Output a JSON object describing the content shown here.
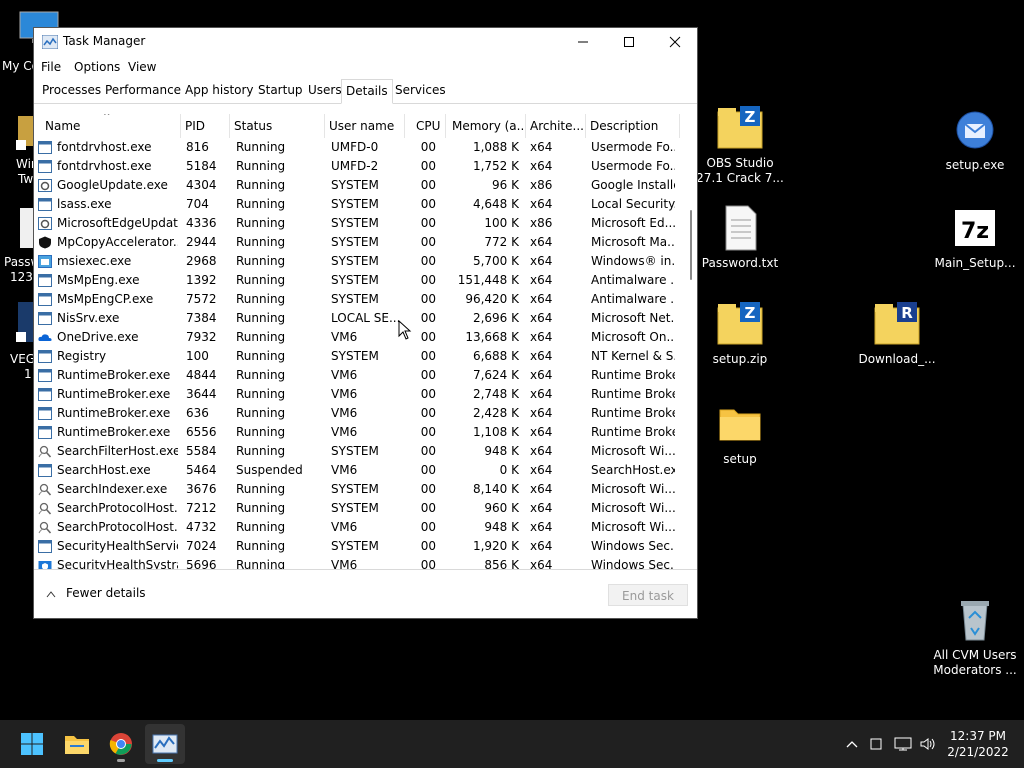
{
  "desktop": {
    "partial_labels": [
      "My Co",
      "Win",
      "Tw",
      "Passw",
      "123",
      "VEG",
      "1"
    ],
    "icons": [
      {
        "label_line1": "OBS Studio",
        "label_line2": "27.1 Crack 7...",
        "icon": "winzip-icon"
      },
      {
        "label_line1": "setup.exe",
        "label_line2": "",
        "icon": "setup-installer-icon"
      },
      {
        "label_line1": "Password.txt",
        "label_line2": "",
        "icon": "text-file-icon"
      },
      {
        "label_line1": "Main_Setup...",
        "label_line2": "",
        "icon": "7zip-icon"
      },
      {
        "label_line1": "setup.zip",
        "label_line2": "",
        "icon": "winzip-icon"
      },
      {
        "label_line1": "Download_...",
        "label_line2": "",
        "icon": "winrar-icon"
      },
      {
        "label_line1": "setup",
        "label_line2": "",
        "icon": "folder-icon"
      },
      {
        "label_line1": "All CVM Users",
        "label_line2": "Moderators ...",
        "icon": "recycle-bin-icon"
      }
    ]
  },
  "window": {
    "title": "Task Manager",
    "menu": [
      "File",
      "Options",
      "View"
    ],
    "tabs": [
      "Processes",
      "Performance",
      "App history",
      "Startup",
      "Users",
      "Details",
      "Services"
    ],
    "active_tab": "Details"
  },
  "table": {
    "columns": [
      "Name",
      "PID",
      "Status",
      "User name",
      "CPU",
      "Memory (a...",
      "Archite...",
      "Description"
    ],
    "rows": [
      {
        "name": "fontdrvhost.exe",
        "pid": "816",
        "status": "Running",
        "user": "UMFD-0",
        "cpu": "00",
        "mem": "1,088 K",
        "arch": "x64",
        "desc": "Usermode Fo...",
        "icon": "app-window-icon"
      },
      {
        "name": "fontdrvhost.exe",
        "pid": "5184",
        "status": "Running",
        "user": "UMFD-2",
        "cpu": "00",
        "mem": "1,752 K",
        "arch": "x64",
        "desc": "Usermode Fo...",
        "icon": "app-window-icon"
      },
      {
        "name": "GoogleUpdate.exe",
        "pid": "4304",
        "status": "Running",
        "user": "SYSTEM",
        "cpu": "00",
        "mem": "96 K",
        "arch": "x86",
        "desc": "Google Installer",
        "icon": "gear-app-icon"
      },
      {
        "name": "lsass.exe",
        "pid": "704",
        "status": "Running",
        "user": "SYSTEM",
        "cpu": "00",
        "mem": "4,648 K",
        "arch": "x64",
        "desc": "Local Security...",
        "icon": "app-window-icon"
      },
      {
        "name": "MicrosoftEdgeUpdat...",
        "pid": "4336",
        "status": "Running",
        "user": "SYSTEM",
        "cpu": "00",
        "mem": "100 K",
        "arch": "x86",
        "desc": "Microsoft Ed...",
        "icon": "gear-app-icon"
      },
      {
        "name": "MpCopyAccelerator....",
        "pid": "2944",
        "status": "Running",
        "user": "SYSTEM",
        "cpu": "00",
        "mem": "772 K",
        "arch": "x64",
        "desc": "Microsoft Ma...",
        "icon": "shield-icon"
      },
      {
        "name": "msiexec.exe",
        "pid": "2968",
        "status": "Running",
        "user": "SYSTEM",
        "cpu": "00",
        "mem": "5,700 K",
        "arch": "x64",
        "desc": "Windows® in...",
        "icon": "installer-icon"
      },
      {
        "name": "MsMpEng.exe",
        "pid": "1392",
        "status": "Running",
        "user": "SYSTEM",
        "cpu": "00",
        "mem": "151,448 K",
        "arch": "x64",
        "desc": "Antimalware ...",
        "icon": "app-window-icon"
      },
      {
        "name": "MsMpEngCP.exe",
        "pid": "7572",
        "status": "Running",
        "user": "SYSTEM",
        "cpu": "00",
        "mem": "96,420 K",
        "arch": "x64",
        "desc": "Antimalware ...",
        "icon": "app-window-icon"
      },
      {
        "name": "NisSrv.exe",
        "pid": "7384",
        "status": "Running",
        "user": "LOCAL SE...",
        "cpu": "00",
        "mem": "2,696 K",
        "arch": "x64",
        "desc": "Microsoft Net...",
        "icon": "app-window-icon"
      },
      {
        "name": "OneDrive.exe",
        "pid": "7932",
        "status": "Running",
        "user": "VM6",
        "cpu": "00",
        "mem": "13,668 K",
        "arch": "x64",
        "desc": "Microsoft On...",
        "icon": "onedrive-icon"
      },
      {
        "name": "Registry",
        "pid": "100",
        "status": "Running",
        "user": "SYSTEM",
        "cpu": "00",
        "mem": "6,688 K",
        "arch": "x64",
        "desc": "NT Kernel & S...",
        "icon": "app-window-icon"
      },
      {
        "name": "RuntimeBroker.exe",
        "pid": "4844",
        "status": "Running",
        "user": "VM6",
        "cpu": "00",
        "mem": "7,624 K",
        "arch": "x64",
        "desc": "Runtime Broker",
        "icon": "app-window-icon"
      },
      {
        "name": "RuntimeBroker.exe",
        "pid": "3644",
        "status": "Running",
        "user": "VM6",
        "cpu": "00",
        "mem": "2,748 K",
        "arch": "x64",
        "desc": "Runtime Broker",
        "icon": "app-window-icon"
      },
      {
        "name": "RuntimeBroker.exe",
        "pid": "636",
        "status": "Running",
        "user": "VM6",
        "cpu": "00",
        "mem": "2,428 K",
        "arch": "x64",
        "desc": "Runtime Broker",
        "icon": "app-window-icon"
      },
      {
        "name": "RuntimeBroker.exe",
        "pid": "6556",
        "status": "Running",
        "user": "VM6",
        "cpu": "00",
        "mem": "1,108 K",
        "arch": "x64",
        "desc": "Runtime Broker",
        "icon": "app-window-icon"
      },
      {
        "name": "SearchFilterHost.exe",
        "pid": "5584",
        "status": "Running",
        "user": "SYSTEM",
        "cpu": "00",
        "mem": "948 K",
        "arch": "x64",
        "desc": "Microsoft Wi...",
        "icon": "search-person-icon"
      },
      {
        "name": "SearchHost.exe",
        "pid": "5464",
        "status": "Suspended",
        "user": "VM6",
        "cpu": "00",
        "mem": "0 K",
        "arch": "x64",
        "desc": "SearchHost.exe",
        "icon": "app-window-icon"
      },
      {
        "name": "SearchIndexer.exe",
        "pid": "3676",
        "status": "Running",
        "user": "SYSTEM",
        "cpu": "00",
        "mem": "8,140 K",
        "arch": "x64",
        "desc": "Microsoft Wi...",
        "icon": "search-person-icon"
      },
      {
        "name": "SearchProtocolHost....",
        "pid": "7212",
        "status": "Running",
        "user": "SYSTEM",
        "cpu": "00",
        "mem": "960 K",
        "arch": "x64",
        "desc": "Microsoft Wi...",
        "icon": "search-person-icon"
      },
      {
        "name": "SearchProtocolHost....",
        "pid": "4732",
        "status": "Running",
        "user": "VM6",
        "cpu": "00",
        "mem": "948 K",
        "arch": "x64",
        "desc": "Microsoft Wi...",
        "icon": "search-person-icon"
      },
      {
        "name": "SecurityHealthServic...",
        "pid": "7024",
        "status": "Running",
        "user": "SYSTEM",
        "cpu": "00",
        "mem": "1,920 K",
        "arch": "x64",
        "desc": "Windows Sec...",
        "icon": "app-window-icon"
      },
      {
        "name": "SecurityHealthSystra...",
        "pid": "5696",
        "status": "Running",
        "user": "VM6",
        "cpu": "00",
        "mem": "856 K",
        "arch": "x64",
        "desc": "Windows Sec...",
        "icon": "security-shield-icon"
      }
    ]
  },
  "footer": {
    "fewer_details": "Fewer details",
    "end_task": "End task"
  },
  "taskbar": {
    "time": "12:37 PM",
    "date": "2/21/2022"
  }
}
